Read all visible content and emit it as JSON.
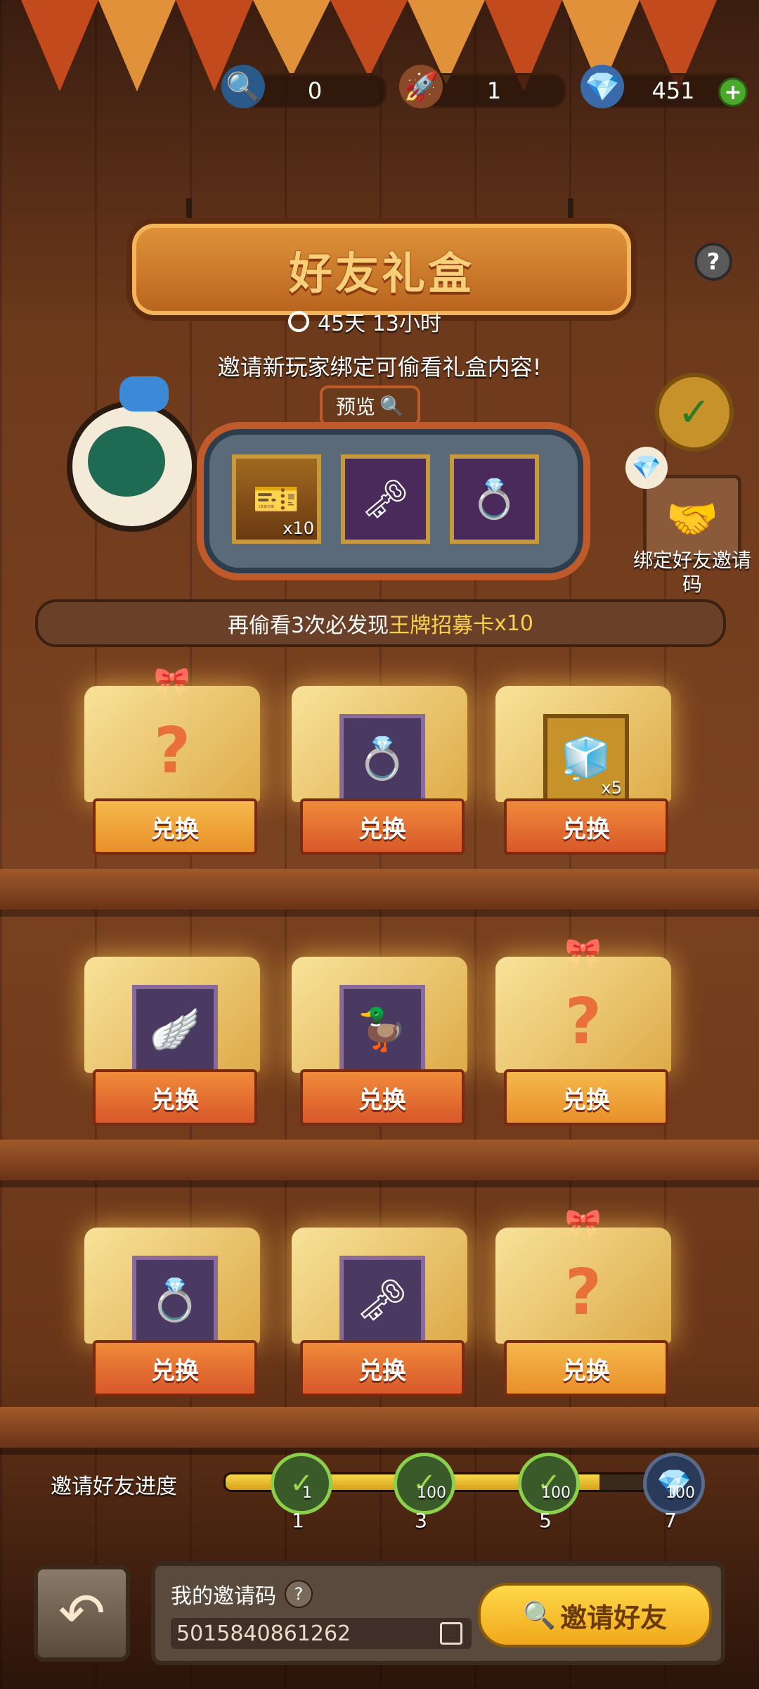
{
  "resources": {
    "magnifier": {
      "icon": "magnifier-icon",
      "value": "0"
    },
    "rocket": {
      "icon": "rocket-icon",
      "value": "1"
    },
    "diamond": {
      "icon": "diamond-icon",
      "value": "451"
    },
    "add": "+"
  },
  "header": {
    "title": "好友礼盒",
    "timer": "45天 13小时",
    "help": "?"
  },
  "instruction": "邀请新玩家绑定可偷看礼盒内容!",
  "preview": {
    "label": "预览",
    "items": [
      {
        "icon": "recruit-card-icon",
        "count": "x10"
      },
      {
        "icon": "key-icon",
        "count": ""
      },
      {
        "icon": "ring-icon",
        "count": ""
      }
    ]
  },
  "bind": {
    "label": "绑定好友邀请码"
  },
  "hint": {
    "prefix": "再偷看3次必发现",
    "highlight": "王牌招募卡",
    "suffix": " x10"
  },
  "boxes": [
    {
      "type": "mystery",
      "button": "兑换"
    },
    {
      "type": "item",
      "icon": "ring-icon",
      "count": "",
      "button": "兑换"
    },
    {
      "type": "item",
      "icon": "cube-icon",
      "count": "x5",
      "button": "兑换"
    },
    {
      "type": "item",
      "icon": "wings-icon",
      "count": "",
      "button": "兑换"
    },
    {
      "type": "item",
      "icon": "duck-character-icon",
      "count": "",
      "button": "兑换"
    },
    {
      "type": "mystery",
      "button": "兑换"
    },
    {
      "type": "item",
      "icon": "ring-icon",
      "count": "",
      "button": "兑换"
    },
    {
      "type": "item",
      "icon": "key-icon",
      "count": "",
      "button": "兑换"
    },
    {
      "type": "mystery",
      "button": "兑换"
    }
  ],
  "progress": {
    "label": "邀请好友进度",
    "fill_fraction": 0.8,
    "nodes": [
      {
        "target": "1",
        "reward": "1",
        "done": true
      },
      {
        "target": "3",
        "reward": "100",
        "done": true
      },
      {
        "target": "5",
        "reward": "100",
        "done": true
      },
      {
        "target": "7",
        "reward": "100",
        "done": false
      }
    ]
  },
  "footer": {
    "code_label": "我的邀请码",
    "code_help": "?",
    "code": "5015840861262",
    "invite_button": "邀请好友"
  }
}
